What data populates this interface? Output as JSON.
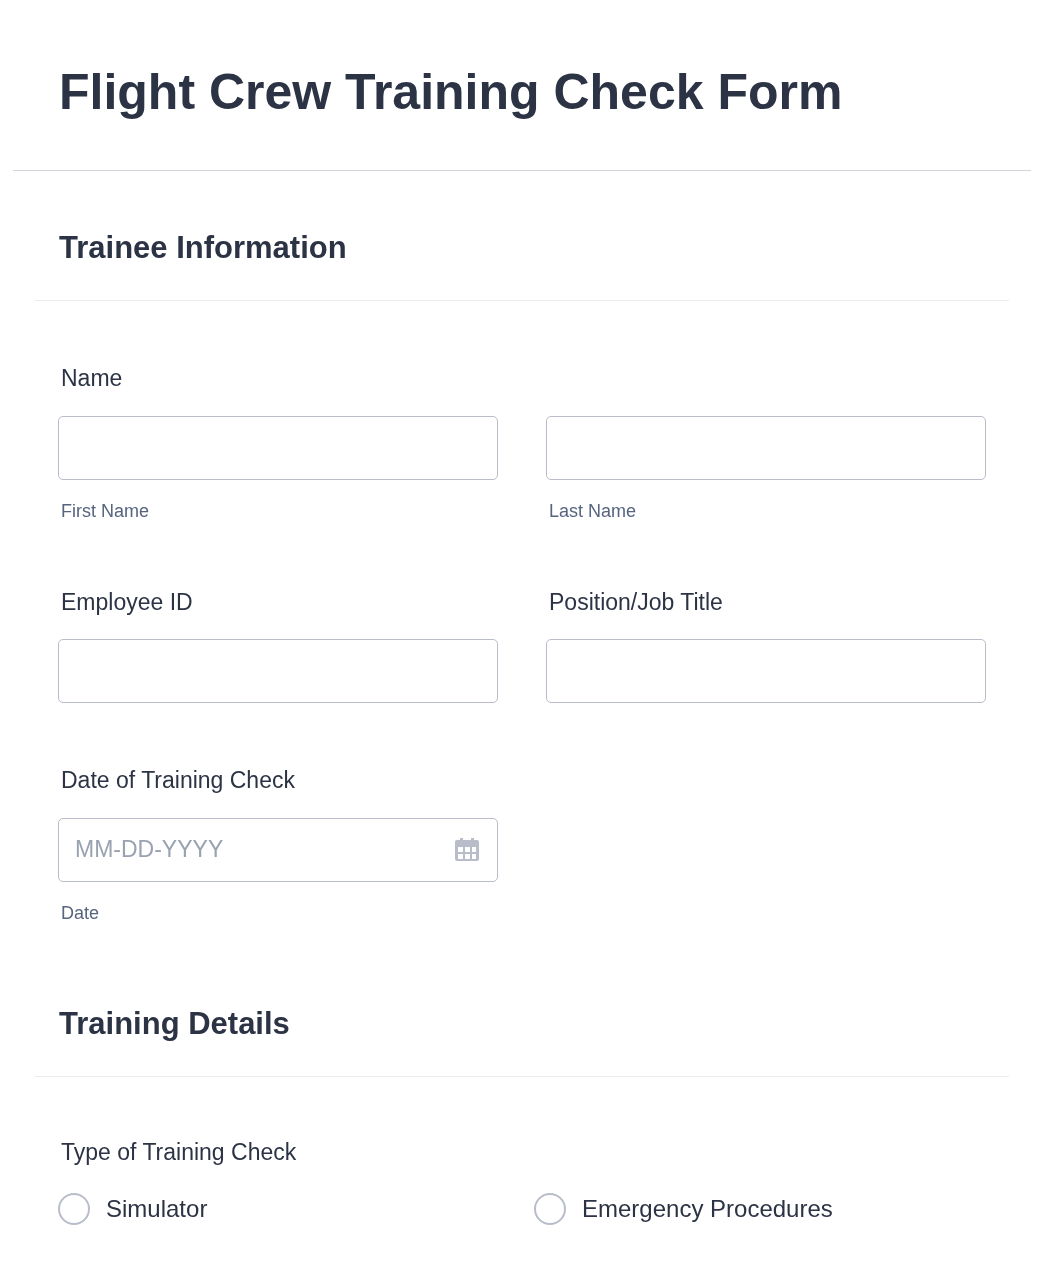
{
  "title": "Flight Crew Training Check Form",
  "sections": [
    {
      "heading": "Trainee Information",
      "fields": [
        {
          "kind": "name",
          "label": "Name",
          "sublabels": [
            "First Name",
            "Last Name"
          ]
        },
        {
          "kind": "pair",
          "items": [
            {
              "label": "Employee ID"
            },
            {
              "label": "Position/Job Title"
            }
          ]
        },
        {
          "kind": "date",
          "label": "Date of Training Check",
          "placeholder": "MM-DD-YYYY",
          "sublabel": "Date"
        }
      ]
    },
    {
      "heading": "Training Details",
      "fields": [
        {
          "kind": "radio",
          "label": "Type of Training Check",
          "options": [
            {
              "label": "Simulator",
              "selected": false
            },
            {
              "label": "Emergency Procedures",
              "selected": false
            }
          ]
        }
      ]
    }
  ]
}
